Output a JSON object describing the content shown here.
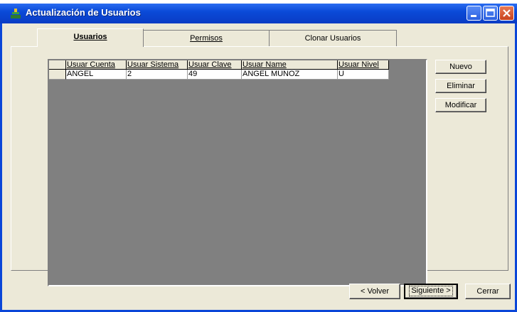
{
  "window": {
    "title": "Actualización de Usuarios"
  },
  "tabs": [
    {
      "label": "Usuarios",
      "active": true
    },
    {
      "label": "Permisos",
      "active": false
    },
    {
      "label": "Clonar Usuarios",
      "active": false
    }
  ],
  "grid": {
    "columns": [
      "Usuar Cuenta",
      "Usuar Sistema",
      "Usuar Clave",
      "Usuar Name",
      "Usuar Nivel"
    ],
    "rows": [
      [
        "ANGEL",
        "2",
        "49",
        "ANGEL MUNOZ",
        "U"
      ]
    ]
  },
  "side_buttons": {
    "nuevo": "Nuevo",
    "eliminar": "Eliminar",
    "modificar": "Modificar"
  },
  "footer_buttons": {
    "volver": "< Volver",
    "siguiente": "Siguiente >",
    "cerrar": "Cerrar"
  },
  "colors": {
    "titlebar": "#0a46d8",
    "client": "#ece9d8",
    "grid_background": "#808080"
  }
}
